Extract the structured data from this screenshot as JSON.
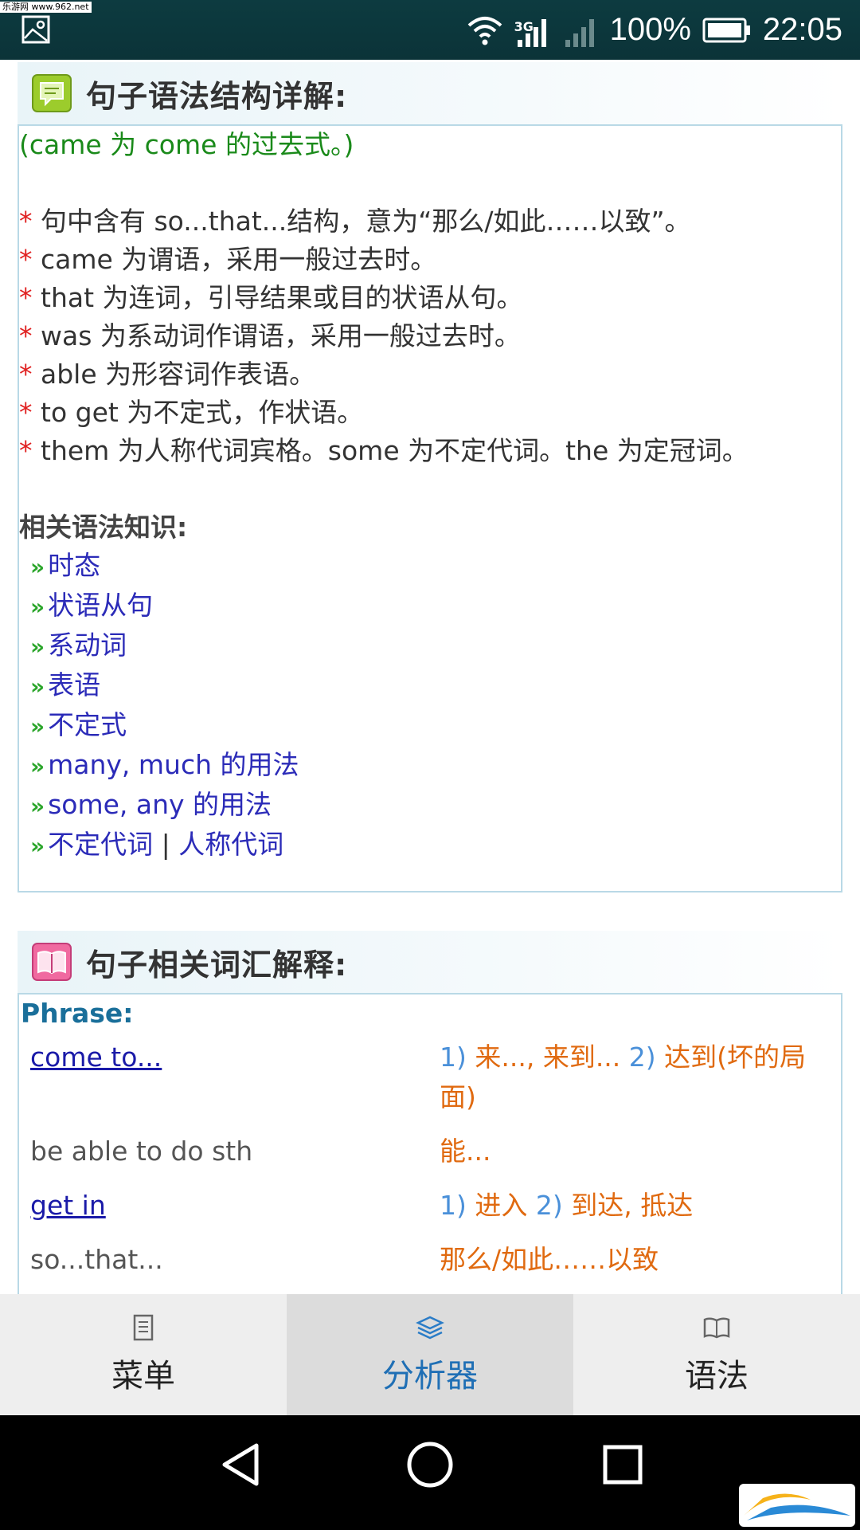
{
  "statusbar": {
    "watermark": "乐游网 www.962.net",
    "network": "3G",
    "battery": "100%",
    "time": "22:05"
  },
  "grammar_section": {
    "title": "句子语法结构详解:",
    "intro": "(came 为 come 的过去式。)",
    "points": [
      "句中含有 so...that...结构，意为“那么/如此……以致”。",
      "came 为谓语，采用一般过去时。",
      "that 为连词，引导结果或目的状语从句。",
      "was 为系动词作谓语，采用一般过去时。",
      "able 为形容词作表语。",
      "to get 为不定式，作状语。",
      "them 为人称代词宾格。some 为不定代词。the 为定冠词。"
    ],
    "related_label": "相关语法知识:",
    "related_links": [
      "时态",
      "状语从句",
      "系动词",
      "表语",
      "不定式",
      "many, much 的用法",
      "some, any 的用法"
    ],
    "last_link_a": "不定代词",
    "last_link_sep": " | ",
    "last_link_b": "人称代词"
  },
  "vocab_section": {
    "title": "句子相关词汇解释:",
    "phrase_label": "Phrase:",
    "rows": [
      {
        "term": "come to...",
        "n1": "1)",
        "d1": " 来..., 来到... ",
        "n2": " 2)",
        "d2": " 达到(坏的局面)"
      },
      {
        "term": "be able to do sth",
        "d1": "能..."
      },
      {
        "term": "get in",
        "n1": "1)",
        "d1": " 进入 ",
        "n2": " 2)",
        "d2": " 到达, 抵达"
      },
      {
        "term": "so...that...",
        "d1": "那么/如此……以致"
      }
    ]
  },
  "tabbar": {
    "tabs": [
      {
        "label": "菜单",
        "icon": "document-icon"
      },
      {
        "label": "分析器",
        "icon": "layers-icon"
      },
      {
        "label": "语法",
        "icon": "open-book-icon"
      }
    ],
    "active_index": 1
  },
  "watermark_logo": "962.NET 乐游网"
}
